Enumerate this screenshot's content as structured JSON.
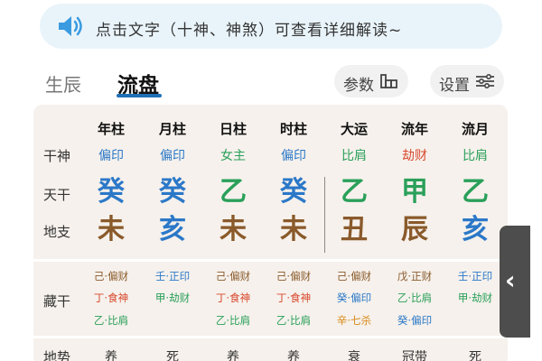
{
  "tip": {
    "text": "点击文字（十神、神煞）可查看详细解读~",
    "icon": "speaker-icon"
  },
  "tabs": [
    {
      "label": "生辰",
      "active": false
    },
    {
      "label": "流盘",
      "active": true
    }
  ],
  "buttons": {
    "params": "参数",
    "settings": "设置"
  },
  "colors": {
    "accent": "#1f6fb5",
    "wood": "#2aa05a",
    "water": "#2b78c8",
    "earth": "#8a5a2b",
    "fire": "#d94a2f",
    "metal": "#d98a1a",
    "table_bg": "#f6f1ec"
  },
  "row_labels": {
    "shishen": "干神",
    "tiangan": "天干",
    "dizhi": "地支",
    "canggan": "藏干",
    "dishi": "地势"
  },
  "columns": [
    {
      "header": "年柱",
      "shishen": "偏印",
      "tiangan": "癸",
      "dizhi": "未",
      "canggan": [
        {
          "text": "己·偏财",
          "color": "brown"
        },
        {
          "text": "丁·食神",
          "color": "red"
        },
        {
          "text": "乙·比肩",
          "color": "green"
        }
      ],
      "dishi": "养"
    },
    {
      "header": "月柱",
      "shishen": "偏印",
      "tiangan": "癸",
      "dizhi": "亥",
      "canggan": [
        {
          "text": "壬·正印",
          "color": "blue"
        },
        {
          "text": "甲·劫财",
          "color": "green"
        }
      ],
      "dishi": "死"
    },
    {
      "header": "日柱",
      "shishen": "女主",
      "tiangan": "乙",
      "dizhi": "未",
      "canggan": [
        {
          "text": "己·偏财",
          "color": "brown"
        },
        {
          "text": "丁·食神",
          "color": "red"
        },
        {
          "text": "乙·比肩",
          "color": "green"
        }
      ],
      "dishi": "养"
    },
    {
      "header": "时柱",
      "shishen": "偏印",
      "tiangan": "癸",
      "dizhi": "未",
      "canggan": [
        {
          "text": "己·偏财",
          "color": "brown"
        },
        {
          "text": "丁·食神",
          "color": "red"
        },
        {
          "text": "乙·比肩",
          "color": "green"
        }
      ],
      "dishi": "养"
    },
    {
      "header": "大运",
      "shishen": "比肩",
      "tiangan": "乙",
      "dizhi": "丑",
      "canggan": [
        {
          "text": "己·偏财",
          "color": "brown"
        },
        {
          "text": "癸·偏印",
          "color": "blue"
        },
        {
          "text": "辛·七杀",
          "color": "orange"
        }
      ],
      "dishi": "衰"
    },
    {
      "header": "流年",
      "shishen": "劫财",
      "tiangan": "甲",
      "dizhi": "辰",
      "canggan": [
        {
          "text": "戊·正财",
          "color": "brown"
        },
        {
          "text": "乙·比肩",
          "color": "green"
        },
        {
          "text": "癸·偏印",
          "color": "blue"
        }
      ],
      "dishi": "冠带"
    },
    {
      "header": "流月",
      "shishen": "比肩",
      "tiangan": "乙",
      "dizhi": "亥",
      "canggan": [
        {
          "text": "壬·正印",
          "color": "blue"
        },
        {
          "text": "甲·劫财",
          "color": "green"
        }
      ],
      "dishi": "死"
    }
  ]
}
